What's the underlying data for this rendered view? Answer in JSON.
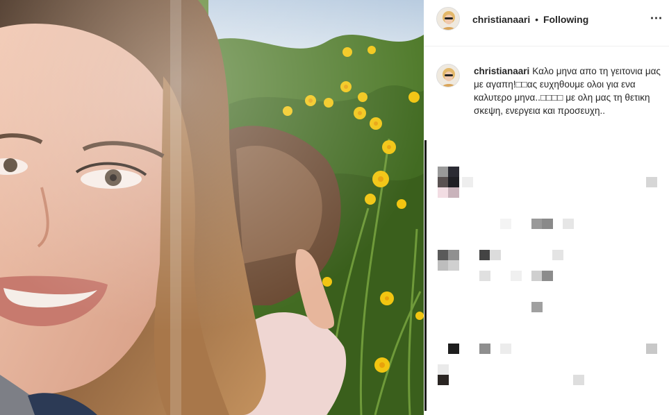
{
  "post": {
    "username": "christianaari",
    "separator": "•",
    "follow_label": "Following",
    "more_icon": "⋯",
    "caption_text": "Καλο μηνα απο τη γειτονια μας με αγαπη!□□ας ευχηθουμε ολοι για ενα καλυτερο μηνα..□□□□ με ολη μας τη θετικη σκεψη, ενεργεια και προσευχη.."
  },
  "colors": {
    "text": "#262626",
    "border": "#efefef",
    "flower": "#f2c511",
    "foliage": "#4f7a2a"
  },
  "pixel_blocks": [
    {
      "c": "#9a9a9a"
    },
    {
      "c": "#2b2b33"
    },
    {
      "c": "#5a5252"
    },
    {
      "c": "#1f1f24"
    },
    {
      "c": "#f2dde3"
    },
    {
      "c": "#c9b3bb"
    },
    {
      "c": "#d6d6d6"
    },
    {
      "c": "#eeeeee"
    },
    {
      "c": "#f4f4f4"
    },
    {
      "c": "#999999"
    },
    {
      "c": "#8a8a8a"
    },
    {
      "c": "#e6e6e6"
    },
    {
      "c": "#5a5a5a"
    },
    {
      "c": "#909090"
    },
    {
      "c": "#bdbdbd"
    },
    {
      "c": "#d0d0d0"
    },
    {
      "c": "#444444"
    },
    {
      "c": "#dcdcdc"
    },
    {
      "c": "#e4e4e4"
    },
    {
      "c": "#e0e0e0"
    },
    {
      "c": "#f0f0f0"
    },
    {
      "c": "#cfcfcf"
    },
    {
      "c": "#8c8c8c"
    },
    {
      "c": "#a0a0a0"
    },
    {
      "c": "#1e1e1e"
    },
    {
      "c": "#8f8f8f"
    },
    {
      "c": "#ececec"
    },
    {
      "c": "#c8c8c8"
    },
    {
      "c": "#eaeaea"
    },
    {
      "c": "#2a2522"
    },
    {
      "c": "#dedede"
    }
  ]
}
